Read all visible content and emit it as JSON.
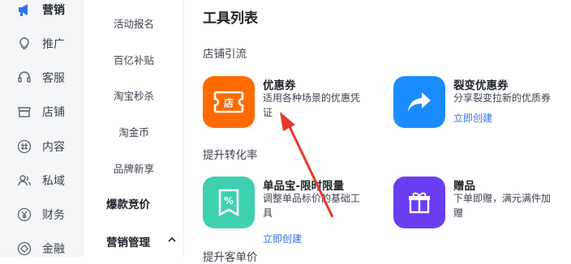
{
  "nav": {
    "items": [
      {
        "label": "营销",
        "icon": "megaphone-icon",
        "active": true
      },
      {
        "label": "推广",
        "icon": "lightbulb-icon"
      },
      {
        "label": "客服",
        "icon": "headset-icon"
      },
      {
        "label": "店铺",
        "icon": "store-icon"
      },
      {
        "label": "内容",
        "icon": "hashtag-icon"
      },
      {
        "label": "私域",
        "icon": "people-icon"
      },
      {
        "label": "财务",
        "icon": "yuan-icon"
      },
      {
        "label": "金融",
        "icon": "coin-icon"
      }
    ]
  },
  "menu": {
    "items": [
      "活动报名",
      "百亿补贴",
      "淘宝秒杀",
      "淘金币",
      "品牌新享"
    ],
    "groups": [
      "爆款竞价",
      "营销管理"
    ]
  },
  "main": {
    "title": "工具列表",
    "sections": [
      "店铺引流",
      "提升转化率",
      "提升客单价"
    ],
    "tools": [
      {
        "name": "优惠券",
        "desc": "适用各种场景的优惠凭证",
        "link": "",
        "icon": "coupon-icon",
        "color": "#ff6b00",
        "glyph": "店"
      },
      {
        "name": "裂变优惠券",
        "desc": "分享裂变拉新的优质券",
        "link": "立即创建",
        "icon": "share-arrow-icon",
        "color": "#1a8cff"
      },
      {
        "name": "单品宝-限时限量",
        "desc": "调整单品标价的基础工具",
        "link": "立即创建",
        "icon": "discount-icon",
        "color": "#3ed1b0",
        "glyph": "%"
      },
      {
        "name": "赠品",
        "desc": "下单即赠，满元满件加赠",
        "link": "",
        "icon": "gift-icon",
        "color": "#6a3df2"
      }
    ]
  },
  "colors": {
    "accent": "#2f73e6",
    "arrow": "#e8372c"
  }
}
